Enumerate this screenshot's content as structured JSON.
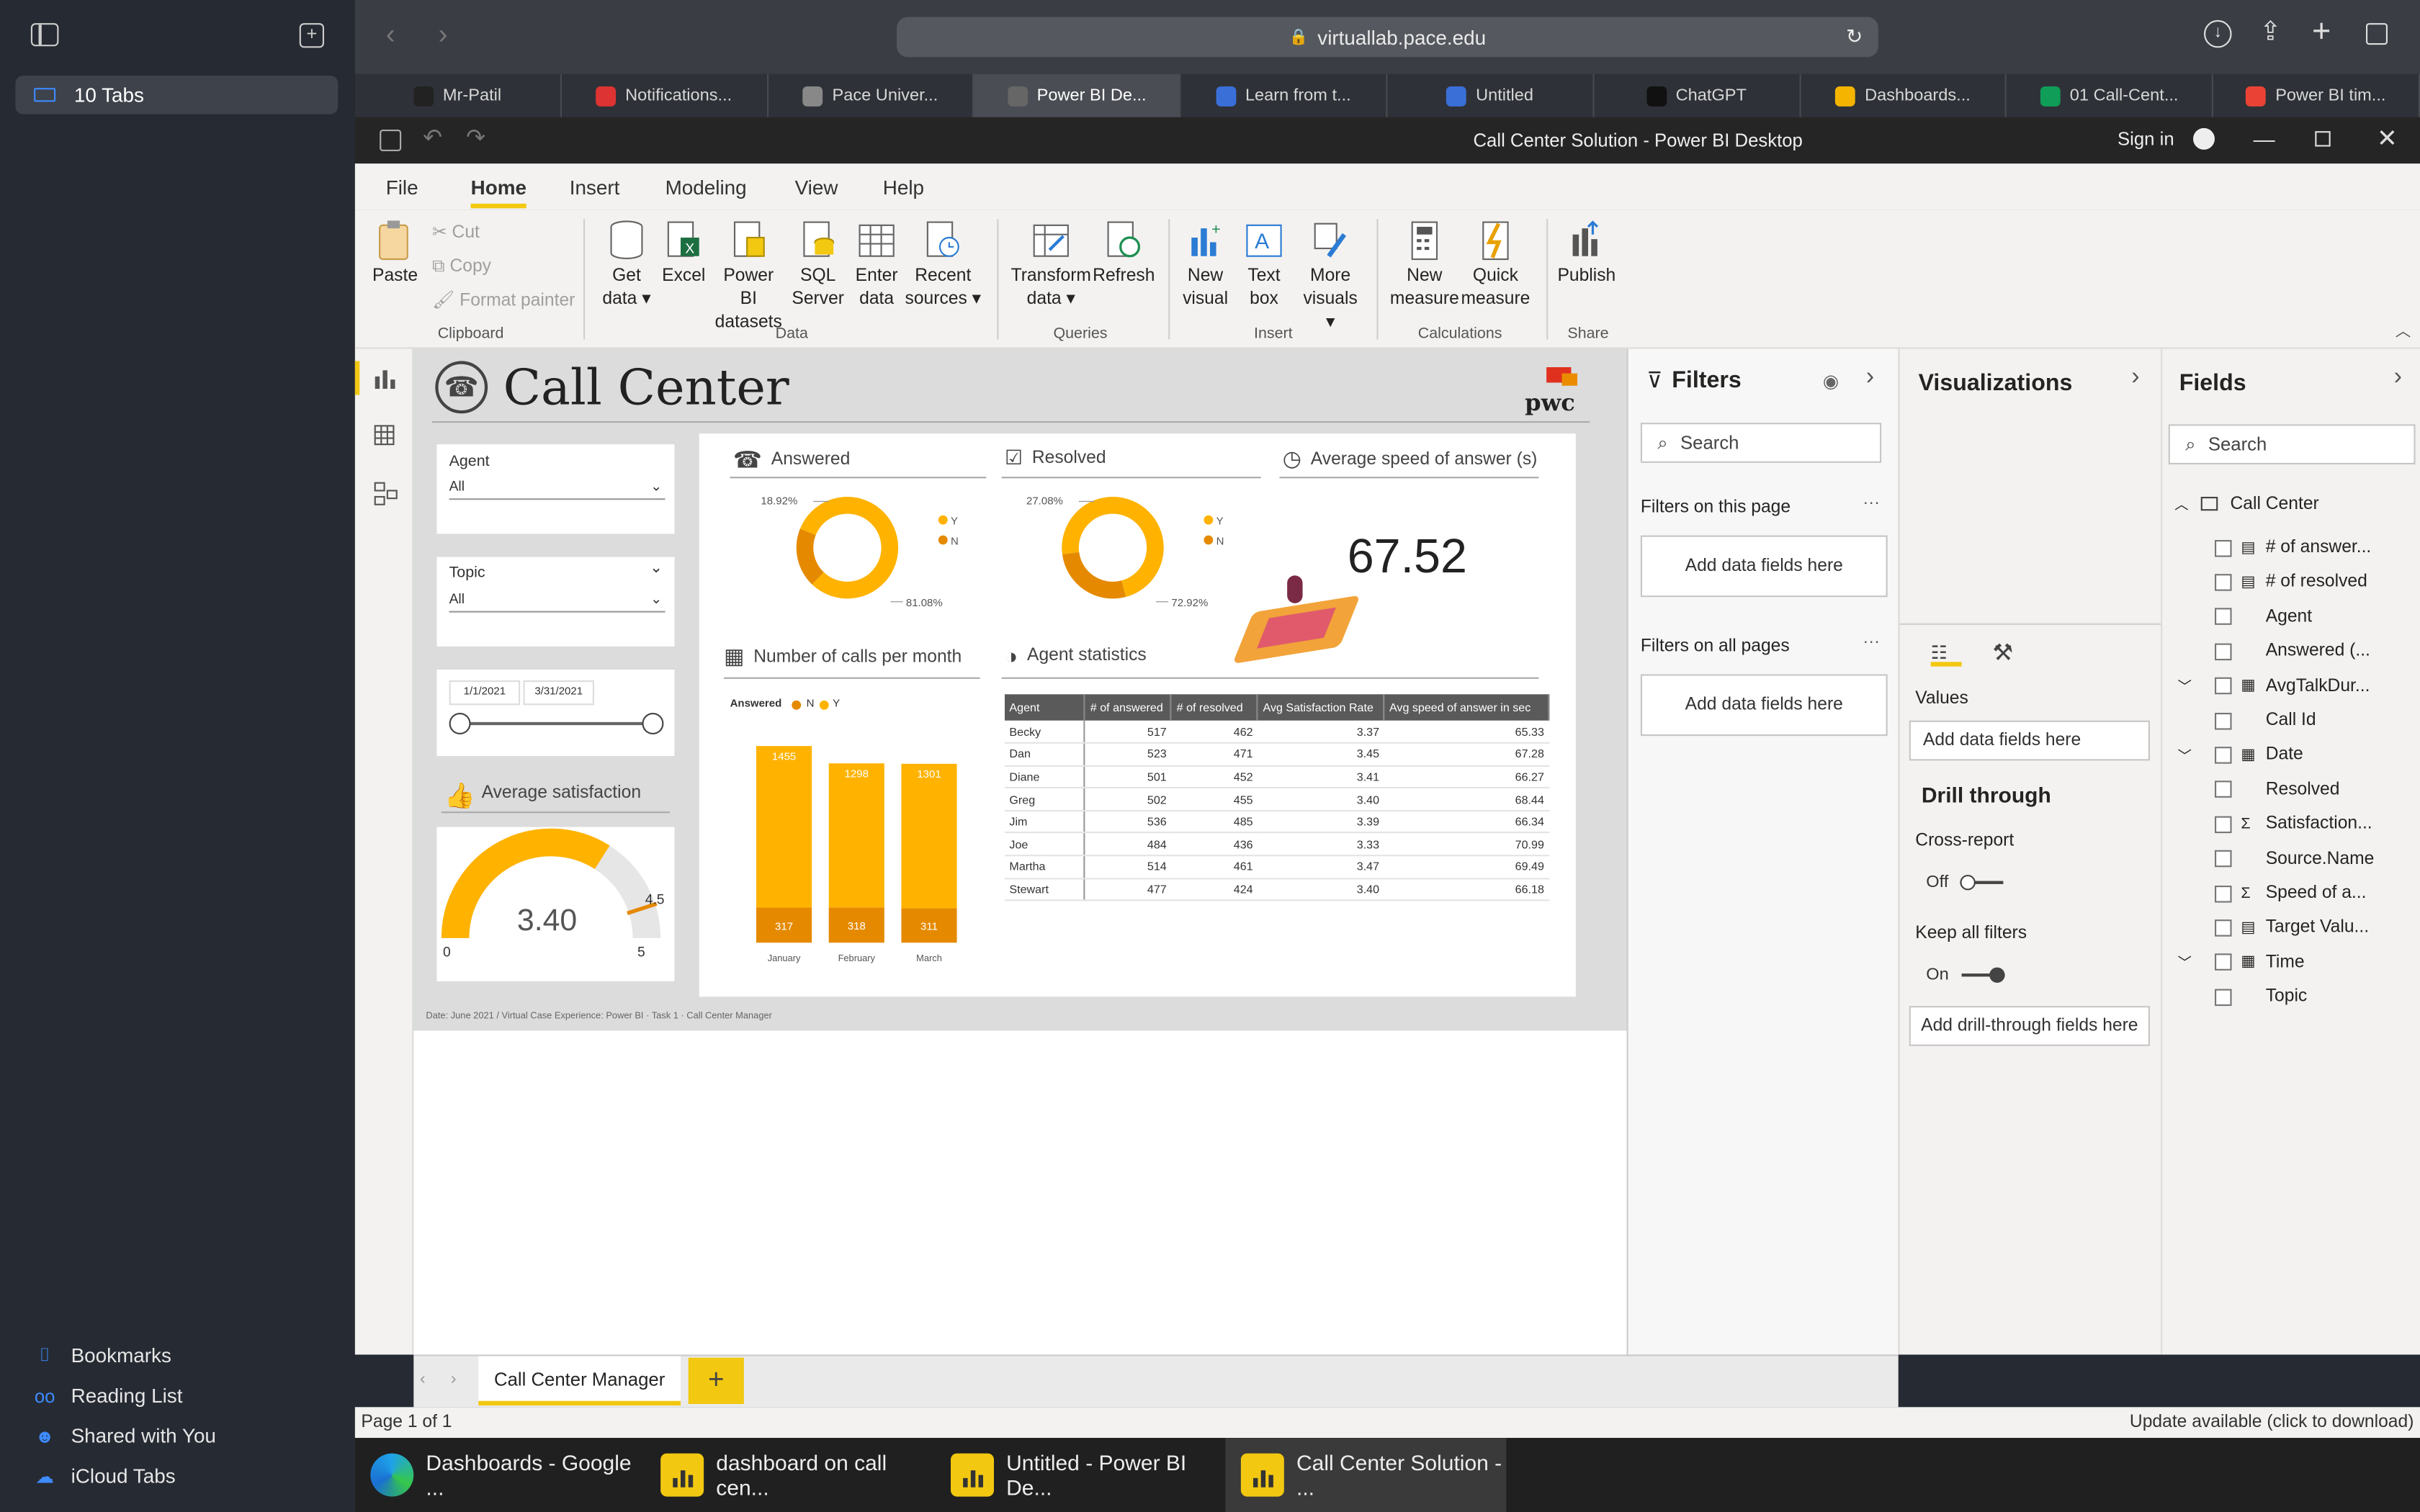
{
  "sidebar": {
    "tabs_label": "10 Tabs",
    "links": [
      "Bookmarks",
      "Reading List",
      "Shared with You",
      "iCloud Tabs"
    ]
  },
  "browser": {
    "url": "virtuallab.pace.edu",
    "tabs": [
      "Mr-Patil",
      "Notifications...",
      "Pace Univer...",
      "Power BI De...",
      "Learn from t...",
      "Untitled",
      "ChatGPT",
      "Dashboards...",
      "01 Call-Cent...",
      "Power BI tim..."
    ],
    "active_tab": 3
  },
  "app": {
    "title": "Call Center Solution - Power BI Desktop",
    "signin": "Sign in"
  },
  "ribbon": {
    "tabs": [
      "File",
      "Home",
      "Insert",
      "Modeling",
      "View",
      "Help"
    ],
    "clipboard": {
      "paste": "Paste",
      "cut": "Cut",
      "copy": "Copy",
      "format_painter": "Format painter",
      "group": "Clipboard"
    },
    "data": {
      "get_data_1": "Get",
      "get_data_2": "data ▾",
      "excel": "Excel",
      "pbi_1": "Power BI",
      "pbi_2": "datasets",
      "sql_1": "SQL",
      "sql_2": "Server",
      "enter_1": "Enter",
      "enter_2": "data",
      "recent_1": "Recent",
      "recent_2": "sources ▾",
      "group": "Data"
    },
    "queries": {
      "transform_1": "Transform",
      "transform_2": "data ▾",
      "refresh": "Refresh",
      "group": "Queries"
    },
    "insert": {
      "newvisual_1": "New",
      "newvisual_2": "visual",
      "textbox_1": "Text",
      "textbox_2": "box",
      "more_1": "More",
      "more_2": "visuals ▾",
      "group": "Insert"
    },
    "calculations": {
      "newmeasure_1": "New",
      "newmeasure_2": "measure",
      "quick_1": "Quick",
      "quick_2": "measure",
      "group": "Calculations"
    },
    "share": {
      "publish": "Publish",
      "group": "Share"
    }
  },
  "report": {
    "title": "Call Center",
    "logo": "pwc",
    "agent_label": "Agent",
    "agent_value": "All",
    "topic_label": "Topic",
    "topic_value": "All",
    "date_start": "1/1/2021",
    "date_end": "3/31/2021",
    "avg_sat_title": "Average satisfaction",
    "avg_sat_value": "3.40",
    "gauge_min": "0",
    "gauge_max": "5",
    "gauge_target": "4.5",
    "answered_title": "Answered",
    "answered_pct_n": "18.92%",
    "answered_pct_y": "81.08%",
    "resolved_title": "Resolved",
    "resolved_pct_n": "27.08%",
    "resolved_pct_y": "72.92%",
    "legend_y": "Y",
    "legend_n": "N",
    "speed_title": "Average speed of answer (s)",
    "speed_value": "67.52",
    "calls_title": "Number of calls per month",
    "calls_legend_label": "Answered",
    "calls_legend_n": "N",
    "calls_legend_y": "Y",
    "agent_stats_title": "Agent statistics",
    "footer": "Date: June 2021 / Virtual Case Experience: Power BI · Task 1 · Call Center Manager",
    "table_headers": [
      "Agent",
      "# of answered",
      "# of resolved",
      "Avg Satisfaction Rate",
      "Avg speed of answer in sec"
    ],
    "table_rows": [
      [
        "Becky",
        "517",
        "462",
        "3.37",
        "65.33"
      ],
      [
        "Dan",
        "523",
        "471",
        "3.45",
        "67.28"
      ],
      [
        "Diane",
        "501",
        "452",
        "3.41",
        "66.27"
      ],
      [
        "Greg",
        "502",
        "455",
        "3.40",
        "68.44"
      ],
      [
        "Jim",
        "536",
        "485",
        "3.39",
        "66.34"
      ],
      [
        "Joe",
        "484",
        "436",
        "3.33",
        "70.99"
      ],
      [
        "Martha",
        "514",
        "461",
        "3.47",
        "69.49"
      ],
      [
        "Stewart",
        "477",
        "424",
        "3.40",
        "66.18"
      ]
    ]
  },
  "chart_data": [
    {
      "type": "bar",
      "title": "Number of calls per month",
      "categories": [
        "January",
        "February",
        "March"
      ],
      "series": [
        {
          "name": "Y",
          "values": [
            1455,
            1298,
            1301
          ]
        },
        {
          "name": "N",
          "values": [
            317,
            318,
            311
          ]
        }
      ]
    },
    {
      "type": "pie",
      "title": "Answered",
      "categories": [
        "Y",
        "N"
      ],
      "values": [
        81.08,
        18.92
      ]
    },
    {
      "type": "pie",
      "title": "Resolved",
      "categories": [
        "Y",
        "N"
      ],
      "values": [
        72.92,
        27.08
      ]
    }
  ],
  "filters": {
    "title": "Filters",
    "search": "Search",
    "on_page": "Filters on this page",
    "on_all": "Filters on all pages",
    "add": "Add data fields here"
  },
  "visualizations": {
    "title": "Visualizations",
    "values": "Values",
    "add": "Add data fields here",
    "drill": "Drill through",
    "cross": "Cross-report",
    "off": "Off",
    "keep": "Keep all filters",
    "on": "On",
    "add_drill": "Add drill-through fields here"
  },
  "fields": {
    "title": "Fields",
    "search": "Search",
    "table": "Call Center",
    "items": [
      "# of answer...",
      "# of resolved",
      "Agent",
      "Answered (...",
      "AvgTalkDur...",
      "Call Id",
      "Date",
      "Resolved",
      "Satisfaction...",
      "Source.Name",
      "Speed of a...",
      "Target Valu...",
      "Time",
      "Topic"
    ]
  },
  "pagetab": "Call Center Manager",
  "status": {
    "page": "Page 1 of 1",
    "update": "Update available (click to download)"
  },
  "taskbar": [
    "Dashboards - Google ...",
    "dashboard on call cen...",
    "Untitled - Power BI De...",
    "Call Center Solution - ..."
  ],
  "colors": {
    "accent": "#ffb300",
    "accent_dark": "#e58a00",
    "ribbon": "#f3f2f1"
  }
}
